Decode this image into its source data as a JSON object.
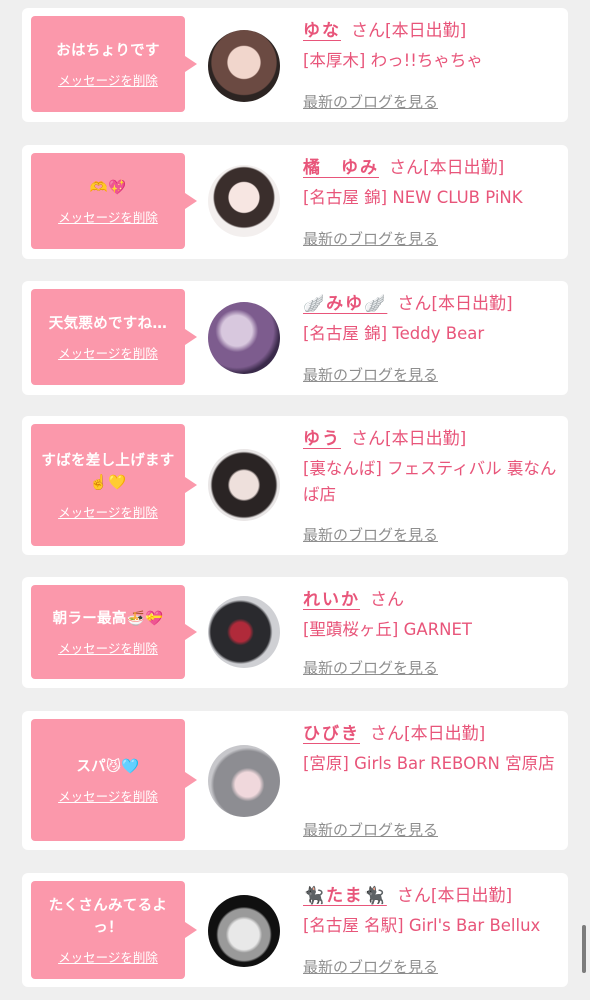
{
  "delete_label": "メッセージを削除",
  "blog_label": "最新のブログを見る",
  "cards": [
    {
      "message": "おはちょりです",
      "name": "ゆな",
      "honorific": "さん",
      "status": "[本日出勤]",
      "shop": "[本厚木] わっ!!ちゃちゃ"
    },
    {
      "message": "🫶💖",
      "name": "橘　ゆみ",
      "honorific": "さん",
      "status": "[本日出勤]",
      "shop": "[名古屋 錦] NEW CLUB PiNK"
    },
    {
      "message": "天気悪めですね…",
      "name": "🪽みゆ🪽",
      "honorific": "さん",
      "status": "[本日出勤]",
      "shop": "[名古屋 錦] Teddy Bear"
    },
    {
      "message": "すばを差し上げます☝️💛",
      "name": "ゆう",
      "honorific": "さん",
      "status": "[本日出勤]",
      "shop": "[裏なんば] フェスティバル 裏なんば店"
    },
    {
      "message": "朝ラー最高🍜💝",
      "name": "れいか",
      "honorific": "さん",
      "status": "",
      "shop": "[聖蹟桜ヶ丘] GARNET"
    },
    {
      "message": "スパ😼🩵",
      "name": "ひびき",
      "honorific": "さん",
      "status": "[本日出勤]",
      "shop": "[宮原] Girls Bar REBORN 宮原店"
    },
    {
      "message": "たくさんみてるよっ！",
      "name": "🐈‍⬛たま🐈‍⬛",
      "honorific": "さん",
      "status": "[本日出勤]",
      "shop": "[名古屋 名駅] Girl's Bar Bellux"
    }
  ],
  "colors": {
    "accent": "#e8557a",
    "bubble": "#fb98ab",
    "link_gray": "#8e8e8e",
    "background": "#efefef"
  }
}
